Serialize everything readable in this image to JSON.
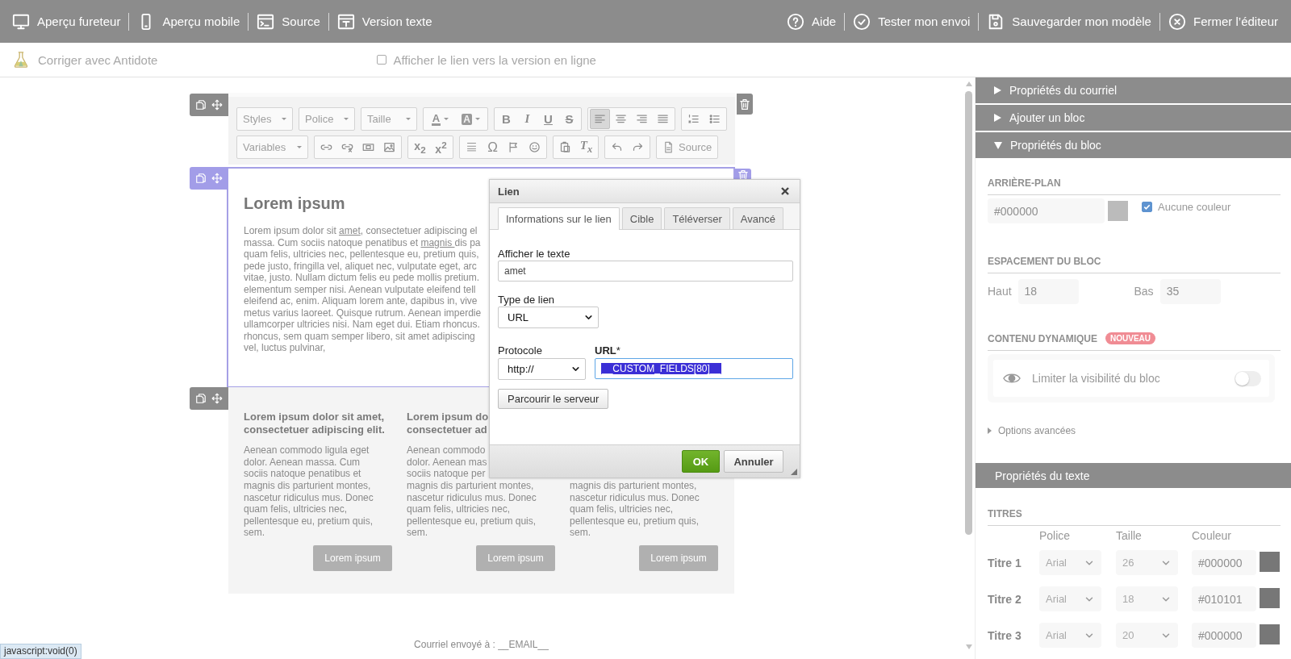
{
  "top_bar": {
    "left": [
      {
        "kind": "monitor",
        "label": "Aperçu fureteur"
      },
      {
        "kind": "phone",
        "label": "Aperçu mobile"
      },
      {
        "kind": "terminal",
        "label": "Source"
      },
      {
        "kind": "textdoc",
        "label": "Version texte"
      }
    ],
    "right": [
      {
        "kind": "help",
        "label": "Aide"
      },
      {
        "kind": "check",
        "label": "Tester mon envoi"
      },
      {
        "kind": "save",
        "label": "Sauvegarder mon modèle"
      },
      {
        "kind": "close",
        "label": "Fermer l’éditeur"
      }
    ]
  },
  "sub_bar": {
    "antidote": "Corriger avec Antidote",
    "online_link": {
      "label": "Afficher le lien vers la version en ligne",
      "checked": false
    }
  },
  "editor_toolbar": {
    "rows": [
      [
        {
          "kind": "combo",
          "label": "Styles"
        },
        {
          "kind": "combo",
          "label": "Police"
        },
        {
          "kind": "combo",
          "label": "Taille"
        },
        {
          "kind": "buttons",
          "items": [
            {
              "kind": "text-color",
              "label": "A",
              "on": false
            },
            {
              "kind": "bg-color",
              "label": "A",
              "on": false
            }
          ]
        },
        {
          "kind": "buttons",
          "items": [
            {
              "kind": "bold",
              "label": "B",
              "on": false
            },
            {
              "kind": "italic",
              "label": "I",
              "on": false
            },
            {
              "kind": "underline",
              "label": "U",
              "on": false
            },
            {
              "kind": "strike",
              "label": "S",
              "on": false
            }
          ]
        },
        {
          "kind": "buttons",
          "items": [
            {
              "kind": "align-left",
              "on": true
            },
            {
              "kind": "align-center",
              "on": false
            },
            {
              "kind": "align-right",
              "on": false
            },
            {
              "kind": "justify",
              "on": false
            }
          ]
        },
        {
          "kind": "buttons",
          "items": [
            {
              "kind": "numbered",
              "on": false
            },
            {
              "kind": "bulleted",
              "on": false
            }
          ]
        }
      ],
      [
        {
          "kind": "combo",
          "label": "Variables"
        },
        {
          "kind": "buttons",
          "items": [
            {
              "kind": "link",
              "on": false
            },
            {
              "kind": "unlink",
              "on": false
            },
            {
              "kind": "textfield",
              "on": false
            },
            {
              "kind": "image",
              "on": false
            }
          ]
        },
        {
          "kind": "buttons",
          "items": [
            {
              "kind": "subscript",
              "label": "x$_{2}$",
              "on": false
            },
            {
              "kind": "superscript",
              "label": "x$^{2}$",
              "on": false
            }
          ]
        },
        {
          "kind": "buttons",
          "items": [
            {
              "kind": "hr",
              "on": false
            },
            {
              "kind": "symbol",
              "label": "Ω",
              "on": false
            },
            {
              "kind": "flag",
              "on": false
            },
            {
              "kind": "smiley",
              "on": false
            }
          ]
        },
        {
          "kind": "buttons",
          "items": [
            {
              "kind": "paste",
              "on": false
            },
            {
              "kind": "clear-format",
              "label": "T$_{x}$",
              "on": false
            }
          ]
        },
        {
          "kind": "buttons",
          "items": [
            {
              "kind": "undo",
              "on": false
            },
            {
              "kind": "redo",
              "on": false
            }
          ]
        },
        {
          "kind": "source",
          "label": "Source"
        }
      ]
    ]
  },
  "text_block": {
    "heading": "Lorem ipsum",
    "lines": [
      [
        {
          "kind": "text",
          "text": "Lorem ipsum dolor sit "
        },
        {
          "kind": "link",
          "text": "amet"
        },
        {
          "kind": "text",
          "text": ", consectetuer adipiscing el"
        }
      ],
      [
        {
          "kind": "text",
          "text": "massa. Cum sociis natoque penatibus et "
        },
        {
          "kind": "link",
          "text": "magnis "
        },
        {
          "kind": "text",
          "text": "dis pa"
        }
      ],
      [
        {
          "kind": "text",
          "text": "quam felis, ultricies nec, pellentesque eu, pretium quis,"
        }
      ],
      [
        {
          "kind": "text",
          "text": "pede justo, fringilla vel, aliquet nec, vulputate eget, arc"
        }
      ],
      [
        {
          "kind": "text",
          "text": "vitae, justo. Nullam dictum felis eu pede mollis pretium."
        }
      ],
      [
        {
          "kind": "text",
          "text": "elementum semper nisi. Aenean vulputate eleifend tell"
        }
      ],
      [
        {
          "kind": "text",
          "text": "eleifend ac, enim. Aliquam lorem ante, dapibus in, vive"
        }
      ],
      [
        {
          "kind": "text",
          "text": "metus varius laoreet. Quisque rutrum. Aenean imperdie"
        }
      ],
      [
        {
          "kind": "text",
          "text": "ullamcorper ultricies nisi. Nam eget dui. Etiam rhoncus."
        }
      ],
      [
        {
          "kind": "text",
          "text": "rhoncus, sem quam semper libero, sit amet adipiscing"
        }
      ],
      [
        {
          "kind": "text",
          "text": "vel, luctus pulvinar,"
        }
      ]
    ]
  },
  "columns_block": {
    "columns": [
      {
        "heading_lines": [
          "Lorem ipsum dolor sit amet,",
          "consectetuer adipiscing elit."
        ],
        "body_lines": [
          "Aenean commodo ligula eget",
          "dolor. Aenean massa. Cum",
          "sociis natoque penatibus et",
          "magnis dis parturient montes,",
          "nascetur ridiculus mus. Donec",
          "quam felis, ultricies nec,",
          "pellentesque eu, pretium quis,",
          "sem."
        ],
        "button": "Lorem ipsum"
      },
      {
        "heading_lines": [
          "Lorem ipsum do",
          "consectetuer ad"
        ],
        "body_lines": [
          "Aenean commodo",
          "dolor. Aenean mas",
          "sociis natoque per",
          "magnis dis parturient montes,",
          "nascetur ridiculus mus. Donec",
          "quam felis, ultricies nec,",
          "pellentesque eu, pretium quis,",
          "sem."
        ],
        "button": "Lorem ipsum"
      },
      {
        "body_lines": [
          "magnis dis parturient montes,",
          "nascetur ridiculus mus. Donec",
          "quam felis, ultricies nec,",
          "pellentesque eu, pretium quis,",
          "sem."
        ],
        "button": "Lorem ipsum"
      }
    ]
  },
  "footer": "Courriel envoyé à : __EMAIL__",
  "link_dialog": {
    "title": "Lien",
    "tabs": [
      {
        "label": "Informations sur le lien",
        "selected": true
      },
      {
        "label": "Cible",
        "selected": false
      },
      {
        "label": "Téléverser",
        "selected": false
      },
      {
        "label": "Avancé",
        "selected": false
      }
    ],
    "display_text": {
      "label": "Afficher le texte",
      "value": "amet"
    },
    "link_type": {
      "label": "Type de lien",
      "value": "URL"
    },
    "protocol": {
      "label": "Protocole",
      "value": "http://"
    },
    "url": {
      "label": "URL",
      "required_mark": "*",
      "value": "__CUSTOM_FIELDS[80]__",
      "text_selected": true
    },
    "browse_button": "Parcourir le serveur",
    "ok_button": "OK",
    "cancel_button": "Annuler"
  },
  "status_tooltip": "javascript:void(0)",
  "side_panel": {
    "sections": [
      {
        "title": "Propriétés du courriel",
        "expanded": false
      },
      {
        "title": "Ajouter un bloc",
        "expanded": false
      },
      {
        "title": "Propriétés du bloc",
        "expanded": true
      }
    ],
    "background": {
      "heading": "ARRIÈRE-PLAN",
      "color_value": "#000000",
      "no_color": {
        "label": "Aucune couleur",
        "checked": true
      }
    },
    "spacing": {
      "heading": "ESPACEMENT DU BLOC",
      "fields": [
        {
          "label": "Haut",
          "value": "18"
        },
        {
          "label": "Bas",
          "value": "35"
        }
      ]
    },
    "dynamic": {
      "heading": "CONTENU DYNAMIQUE",
      "badge": "NOUVEAU",
      "option": {
        "label": "Limiter la visibilité du bloc",
        "on": false
      }
    },
    "advanced": {
      "label": "Options avancées",
      "expanded": false
    },
    "text_props": {
      "title": "Propriétés du texte",
      "heading": "TITRES",
      "columns": [
        "Police",
        "Taille",
        "Couleur"
      ],
      "rows": [
        {
          "label": "Titre 1",
          "font": "Arial",
          "size": "26",
          "color_value": "#000000"
        },
        {
          "label": "Titre 2",
          "font": "Arial",
          "size": "18",
          "color_value": "#010101"
        },
        {
          "label": "Titre 3",
          "font": "Arial",
          "size": "20",
          "color_value": "#000000"
        }
      ]
    }
  }
}
